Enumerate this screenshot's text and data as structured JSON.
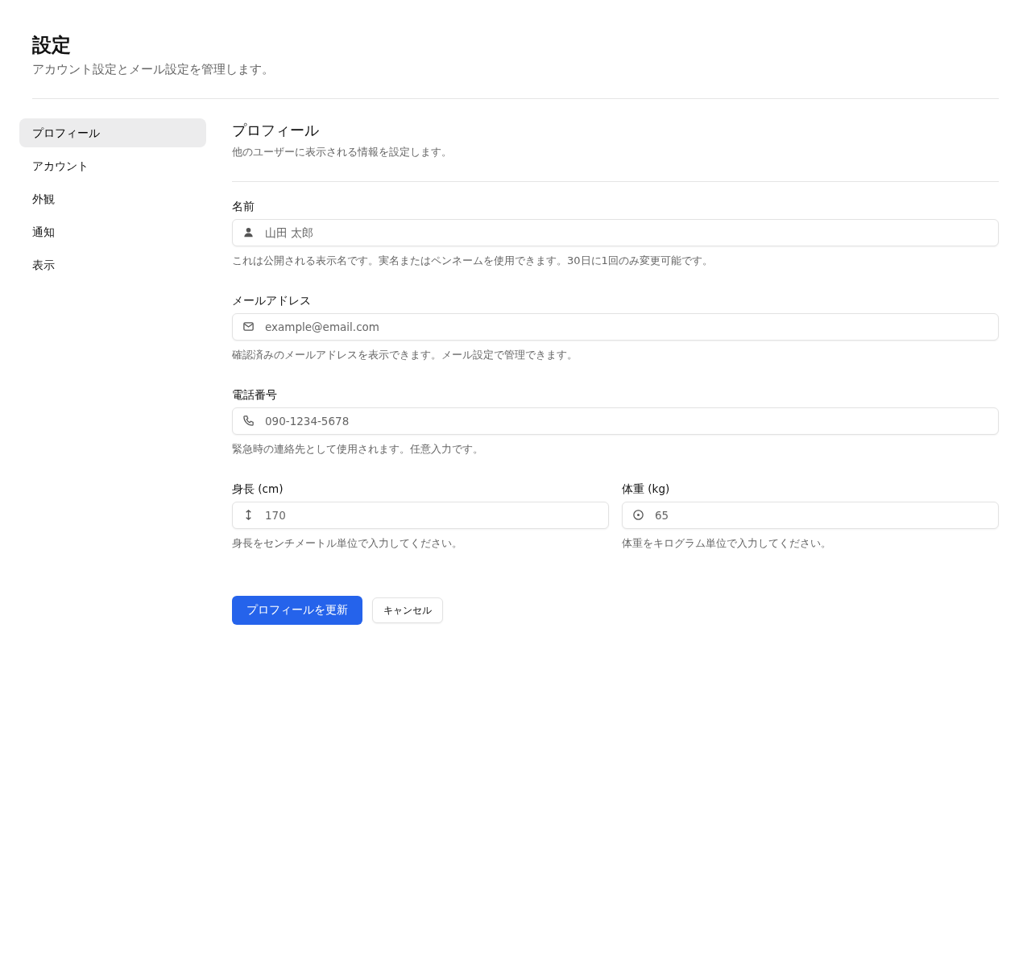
{
  "header": {
    "title": "設定",
    "subtitle": "アカウント設定とメール設定を管理します。"
  },
  "sidebar": {
    "items": [
      {
        "label": "プロフィール",
        "selected": true
      },
      {
        "label": "アカウント",
        "selected": false
      },
      {
        "label": "外観",
        "selected": false
      },
      {
        "label": "通知",
        "selected": false
      },
      {
        "label": "表示",
        "selected": false
      }
    ]
  },
  "section": {
    "title": "プロフィール",
    "description": "他のユーザーに表示される情報を設定します。"
  },
  "form_rows": [
    {
      "fields": [
        {
          "label": "名前",
          "kind": "person",
          "placeholder": "山田 太郎",
          "help": "これは公開される表示名です。実名またはペンネームを使用できます。30日に1回のみ変更可能です。"
        }
      ]
    },
    {
      "fields": [
        {
          "label": "メールアドレス",
          "kind": "mail",
          "placeholder": "example@email.com",
          "help": "確認済みのメールアドレスを表示できます。メール設定で管理できます。"
        }
      ]
    },
    {
      "fields": [
        {
          "label": "電話番号",
          "kind": "phone",
          "placeholder": "090-1234-5678",
          "help": "緊急時の連絡先として使用されます。任意入力です。"
        }
      ]
    },
    {
      "fields": [
        {
          "label": "身長 (cm)",
          "kind": "height",
          "placeholder": "170",
          "help": "身長をセンチメートル単位で入力してください。"
        },
        {
          "label": "体重 (kg)",
          "kind": "weight",
          "placeholder": "65",
          "help": "体重をキログラム単位で入力してください。"
        }
      ]
    }
  ],
  "buttons": [
    {
      "label": "プロフィールを更新",
      "kind": "primary"
    },
    {
      "label": "キャンセル",
      "kind": "secondary"
    }
  ]
}
